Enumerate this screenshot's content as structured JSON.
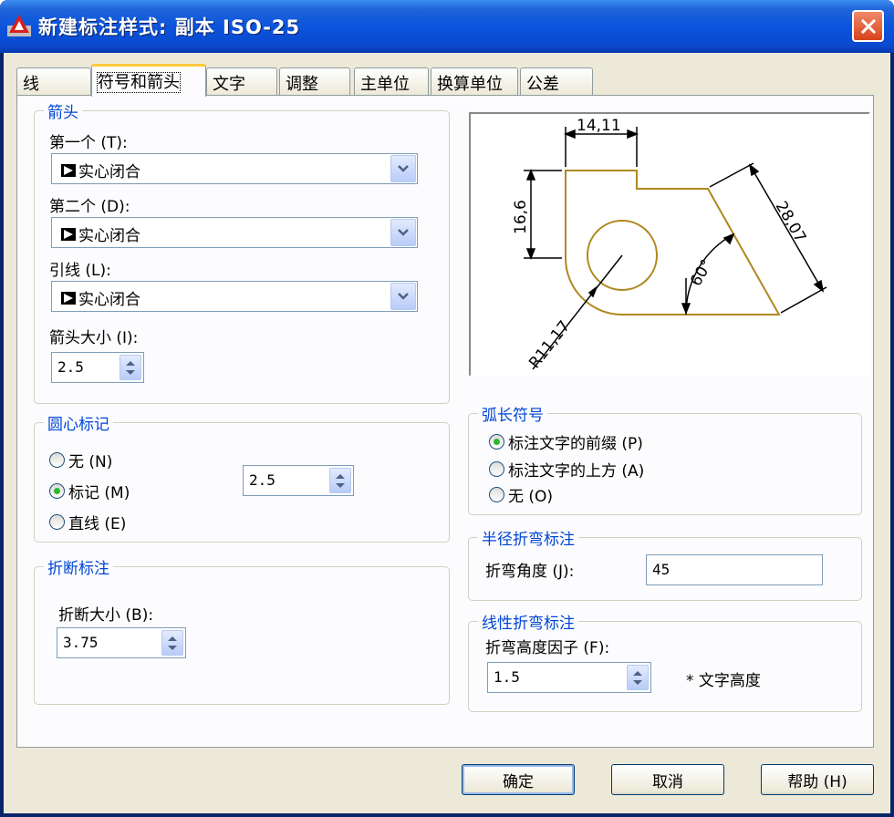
{
  "window": {
    "title": "新建标注样式: 副本 ISO-25"
  },
  "tabs": [
    "线",
    "符号和箭头",
    "文字",
    "调整",
    "主单位",
    "换算单位",
    "公差"
  ],
  "arrowheads": {
    "title": "箭头",
    "first_label": "第一个 (T):",
    "first_value": "实心闭合",
    "second_label": "第二个 (D):",
    "second_value": "实心闭合",
    "leader_label": "引线 (L):",
    "leader_value": "实心闭合",
    "size_label": "箭头大小 (I):",
    "size_value": "2.5"
  },
  "center_marks": {
    "title": "圆心标记",
    "options": [
      "无 (N)",
      "标记 (M)",
      "直线 (E)"
    ],
    "selected": 1,
    "size_value": "2.5"
  },
  "dimension_break": {
    "title": "折断标注",
    "size_label": "折断大小 (B):",
    "size_value": "3.75"
  },
  "preview": {
    "dim_top": "14,11",
    "dim_left": "16,6",
    "dim_right": "28,07",
    "dim_angle": "60°",
    "dim_radius": "R11,17",
    "line_color": "#b08820"
  },
  "arc_length_symbol": {
    "title": "弧长符号",
    "options": [
      "标注文字的前缀 (P)",
      "标注文字的上方 (A)",
      "无 (O)"
    ],
    "selected": 0
  },
  "radius_jog": {
    "title": "半径折弯标注",
    "angle_label": "折弯角度 (J):",
    "angle_value": "45"
  },
  "linear_jog": {
    "title": "线性折弯标注",
    "height_label": "折弯高度因子 (F):",
    "height_value": "1.5",
    "suffix": "* 文字高度"
  },
  "buttons": {
    "ok": "确定",
    "cancel": "取消",
    "help": "帮助 (H)"
  }
}
